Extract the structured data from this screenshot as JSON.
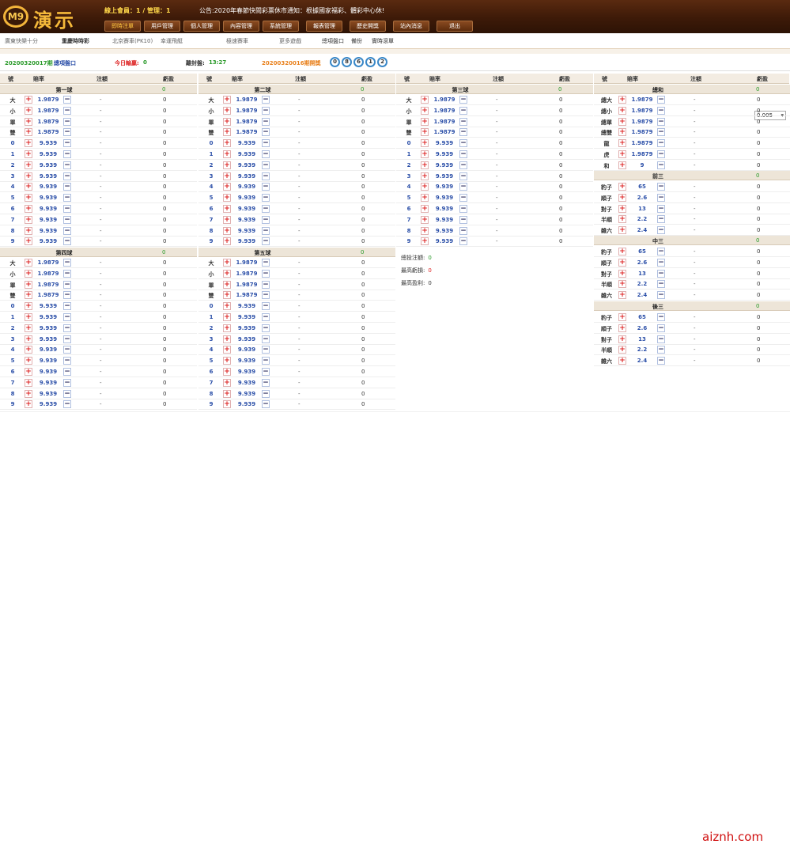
{
  "header": {
    "logo_badge": "M9",
    "logo_text": "演示",
    "user_info": "線上會員：1 / 管理：1",
    "notice": "公告:2020年春節快閱彩票休市通知：根據國家福彩、體彩中心休!",
    "nav": [
      "即時注單",
      "用戶管理",
      "個人管理",
      "內容管理",
      "系統管理",
      "報表管理",
      "歷史開獎",
      "站內消息",
      "退出"
    ],
    "nav_active": 0
  },
  "subnav": [
    "廣東快樂十分",
    "重慶時時彩",
    "北京賽車(PK10)",
    "幸運飛艇",
    "極速賽車",
    "更多遊戲",
    "總項盤口",
    "備份",
    "實時滾單"
  ],
  "infobar": {
    "draw_no": "20200320017期",
    "market": "總項盤口",
    "today_pl_label": "今日輸贏:",
    "today_pl_value": "0",
    "close_label": "離封盤:",
    "close_value": "13:27",
    "last_draw": "20200320016期開獎",
    "balls": [
      "0",
      "8",
      "6",
      "1",
      "2"
    ],
    "odds_step": "0.005"
  },
  "colhdr": {
    "no": "號",
    "odds": "賠率",
    "bet": "注額",
    "pl": "虧盈"
  },
  "groups": {
    "g1": {
      "name": "第一球",
      "zero": "0"
    },
    "g2": {
      "name": "第二球",
      "zero": "0"
    },
    "g3": {
      "name": "第三球",
      "zero": "0"
    },
    "g4": {
      "name": "第四球",
      "zero": "0"
    },
    "g5": {
      "name": "第五球",
      "zero": "0"
    },
    "g6": {
      "name": "總和",
      "zero": "0"
    },
    "g7": {
      "name": "前三",
      "zero": "0"
    },
    "g8": {
      "name": "中三",
      "zero": "0"
    },
    "g9": {
      "name": "後三",
      "zero": "0"
    }
  },
  "ball_rows": [
    {
      "label": "大",
      "odds": "1.9879",
      "bet": "-",
      "pl": "0"
    },
    {
      "label": "小",
      "odds": "1.9879",
      "bet": "-",
      "pl": "0"
    },
    {
      "label": "單",
      "odds": "1.9879",
      "bet": "-",
      "pl": "0"
    },
    {
      "label": "雙",
      "odds": "1.9879",
      "bet": "-",
      "pl": "0"
    },
    {
      "label": "0",
      "odds": "9.939",
      "bet": "-",
      "pl": "0"
    },
    {
      "label": "1",
      "odds": "9.939",
      "bet": "-",
      "pl": "0"
    },
    {
      "label": "2",
      "odds": "9.939",
      "bet": "-",
      "pl": "0"
    },
    {
      "label": "3",
      "odds": "9.939",
      "bet": "-",
      "pl": "0"
    },
    {
      "label": "4",
      "odds": "9.939",
      "bet": "-",
      "pl": "0"
    },
    {
      "label": "5",
      "odds": "9.939",
      "bet": "-",
      "pl": "0"
    },
    {
      "label": "6",
      "odds": "9.939",
      "bet": "-",
      "pl": "0"
    },
    {
      "label": "7",
      "odds": "9.939",
      "bet": "-",
      "pl": "0"
    },
    {
      "label": "8",
      "odds": "9.939",
      "bet": "-",
      "pl": "0"
    },
    {
      "label": "9",
      "odds": "9.939",
      "bet": "-",
      "pl": "0"
    }
  ],
  "sum_rows": [
    {
      "label": "總大",
      "odds": "1.9879",
      "bet": "-",
      "pl": "0"
    },
    {
      "label": "總小",
      "odds": "1.9879",
      "bet": "-",
      "pl": "0"
    },
    {
      "label": "總單",
      "odds": "1.9879",
      "bet": "-",
      "pl": "0"
    },
    {
      "label": "總雙",
      "odds": "1.9879",
      "bet": "-",
      "pl": "0"
    },
    {
      "label": "龍",
      "odds": "1.9879",
      "bet": "-",
      "pl": "0"
    },
    {
      "label": "虎",
      "odds": "1.9879",
      "bet": "-",
      "pl": "0"
    },
    {
      "label": "和",
      "odds": "9",
      "bet": "-",
      "pl": "0"
    }
  ],
  "combo_rows": [
    {
      "label": "豹子",
      "odds": "65",
      "bet": "-",
      "pl": "0"
    },
    {
      "label": "順子",
      "odds": "2.6",
      "bet": "-",
      "pl": "0"
    },
    {
      "label": "對子",
      "odds": "13",
      "bet": "-",
      "pl": "0"
    },
    {
      "label": "半順",
      "odds": "2.2",
      "bet": "-",
      "pl": "0"
    },
    {
      "label": "雜六",
      "odds": "2.4",
      "bet": "-",
      "pl": "0"
    }
  ],
  "stats": [
    {
      "label": "總投注額:",
      "value": "0",
      "color": "#2a9a2a"
    },
    {
      "label": "最高虧損:",
      "value": "0",
      "color": "#d22"
    },
    {
      "label": "最高盈利:",
      "value": "0",
      "color": "#333"
    }
  ],
  "watermark": "aiznh.com",
  "glyphs": {
    "plus": "+",
    "minus": "−"
  }
}
